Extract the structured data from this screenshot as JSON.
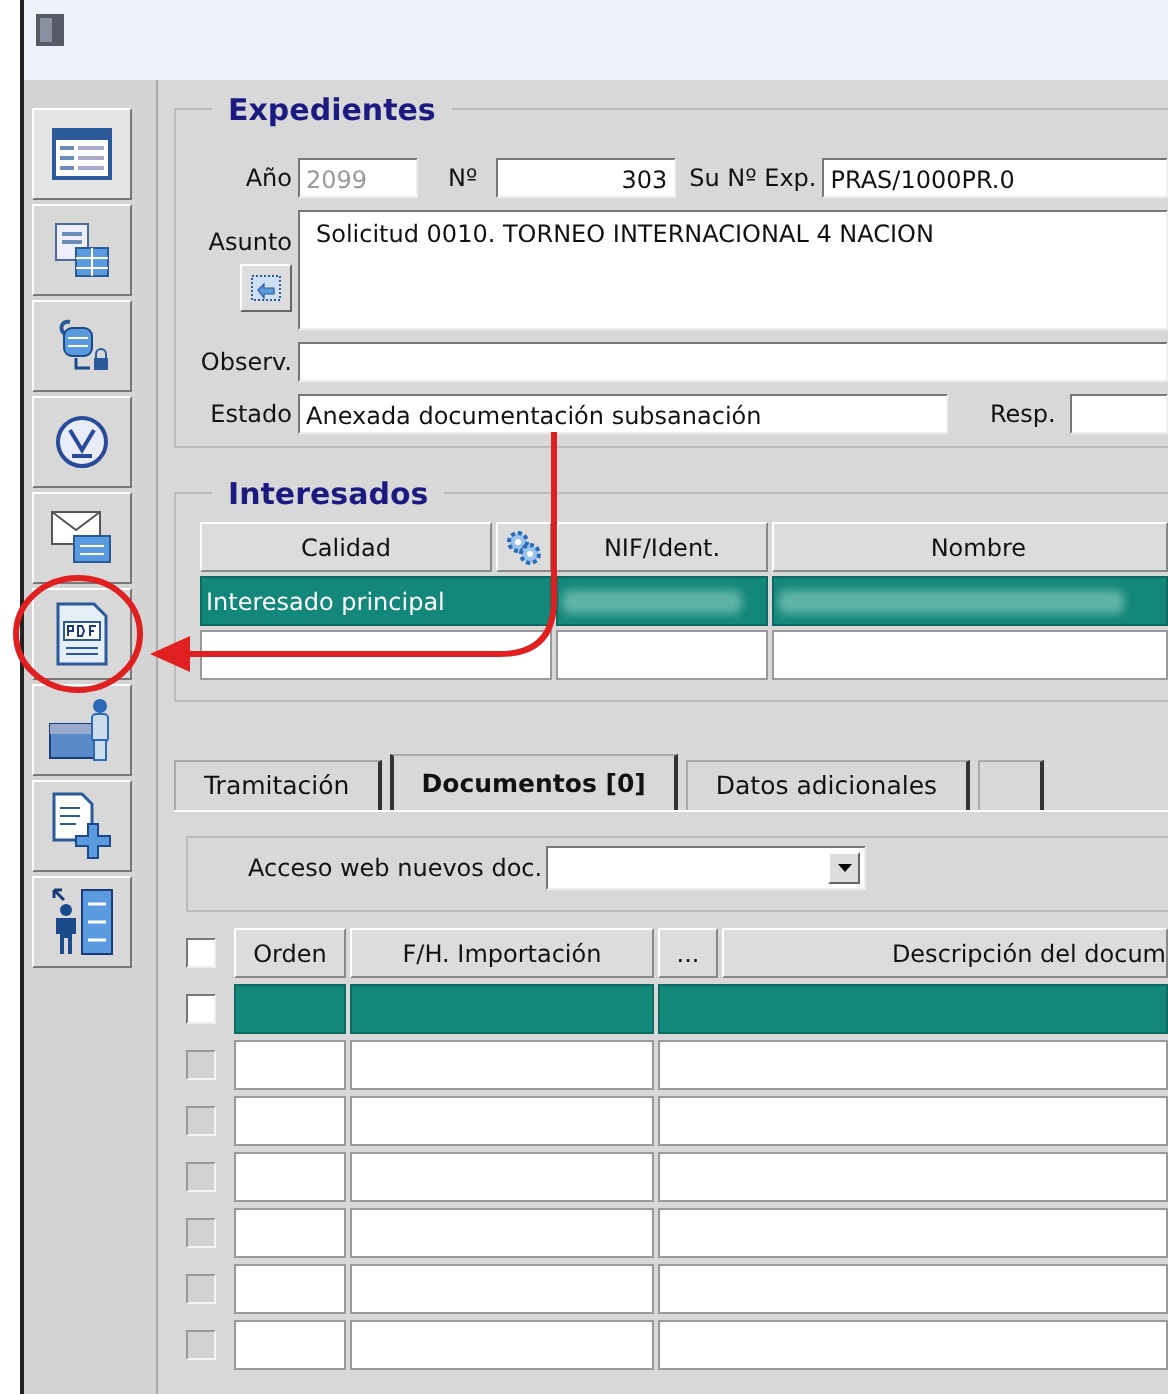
{
  "toolbar": [
    {
      "kind": "form",
      "circled": false
    },
    {
      "kind": "docs",
      "circled": false
    },
    {
      "kind": "lock",
      "circled": false
    },
    {
      "kind": "check",
      "circled": false
    },
    {
      "kind": "mail",
      "circled": false
    },
    {
      "kind": "pdf",
      "circled": true
    },
    {
      "kind": "person",
      "circled": false
    },
    {
      "kind": "add",
      "circled": false
    },
    {
      "kind": "steps",
      "circled": false
    }
  ],
  "expedientes": {
    "title": "Expedientes",
    "fields": [
      {
        "label": "Año",
        "value": "2099",
        "disabled": true
      },
      {
        "label": "Nº",
        "value": "303",
        "disabled": false
      },
      {
        "label": "Su Nº Exp.",
        "value": "PRAS/1000PR.0",
        "disabled": false
      }
    ],
    "asunto": {
      "label": "Asunto",
      "value": "Solicitud 0010. TORNEO INTERNACIONAL 4 NACION"
    },
    "observ": {
      "label": "Observ."
    },
    "estado": {
      "label": "Estado",
      "value": "Anexada documentación subsanación"
    },
    "resp": {
      "label": "Resp."
    }
  },
  "interesados": {
    "title": "Interesados",
    "columns": [
      "Calidad",
      "NIF/Ident.",
      "Nombre"
    ],
    "rows": [
      {
        "calidad": "Interesado principal",
        "selected": true,
        "redacted": true
      },
      {
        "selected": false,
        "redacted": false
      }
    ]
  },
  "tabs": [
    {
      "label": "Tramitación",
      "selected": false
    },
    {
      "label": "Documentos [0]",
      "selected": true
    },
    {
      "label": "Datos adicionales",
      "selected": false
    }
  ],
  "documentos": {
    "acceso_label": "Acceso web nuevos doc.",
    "select_all": {
      "checked": false
    },
    "columns": [
      "Orden",
      "F/H. Importación",
      "...",
      "Descripción del docum"
    ],
    "rows": [
      {
        "selected": true,
        "checked": false,
        "disabled": false
      },
      {
        "selected": false,
        "checked": false,
        "disabled": true
      },
      {
        "selected": false,
        "checked": false,
        "disabled": true
      },
      {
        "selected": false,
        "checked": false,
        "disabled": true
      },
      {
        "selected": false,
        "checked": false,
        "disabled": true
      },
      {
        "selected": false,
        "checked": false,
        "disabled": true
      },
      {
        "selected": false,
        "checked": false,
        "disabled": true
      }
    ]
  }
}
